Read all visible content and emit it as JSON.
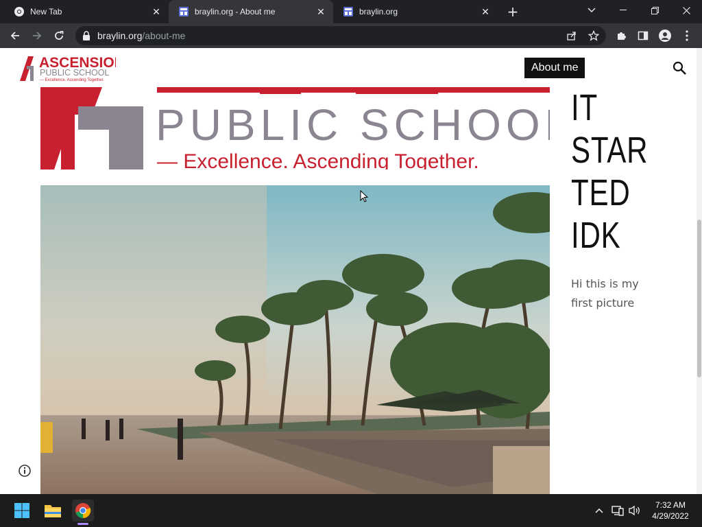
{
  "browser": {
    "tabs": [
      {
        "title": "New Tab",
        "active": false,
        "icon": "chrome-icon"
      },
      {
        "title": "braylin.org - About me",
        "active": true,
        "icon": "site-favicon"
      },
      {
        "title": "braylin.org",
        "active": false,
        "icon": "site-favicon"
      }
    ],
    "url_domain": "braylin.org",
    "url_path": "/about-me"
  },
  "site": {
    "logo_text": "ASCENSION",
    "logo_subtext": "PUBLIC SCHOOL",
    "logo_tagline": "— Excellence. Ascending Together.",
    "nav": {
      "about_label": "About me"
    }
  },
  "hero": {
    "logo_line1": "PUBLIC SCHOOL",
    "logo_line2": "— Excellence. Ascending Together."
  },
  "post": {
    "heading_lines": [
      "IT",
      "STAR",
      "TED",
      "IDK"
    ],
    "caption": "Hi this is my first picture"
  },
  "taskbar": {
    "time": "7:32 AM",
    "date": "4/29/2022"
  },
  "colors": {
    "brand_red": "#c8202f",
    "brand_gray": "#8a8590",
    "chrome_dark": "#202124",
    "chrome_toolbar": "#35363a"
  }
}
